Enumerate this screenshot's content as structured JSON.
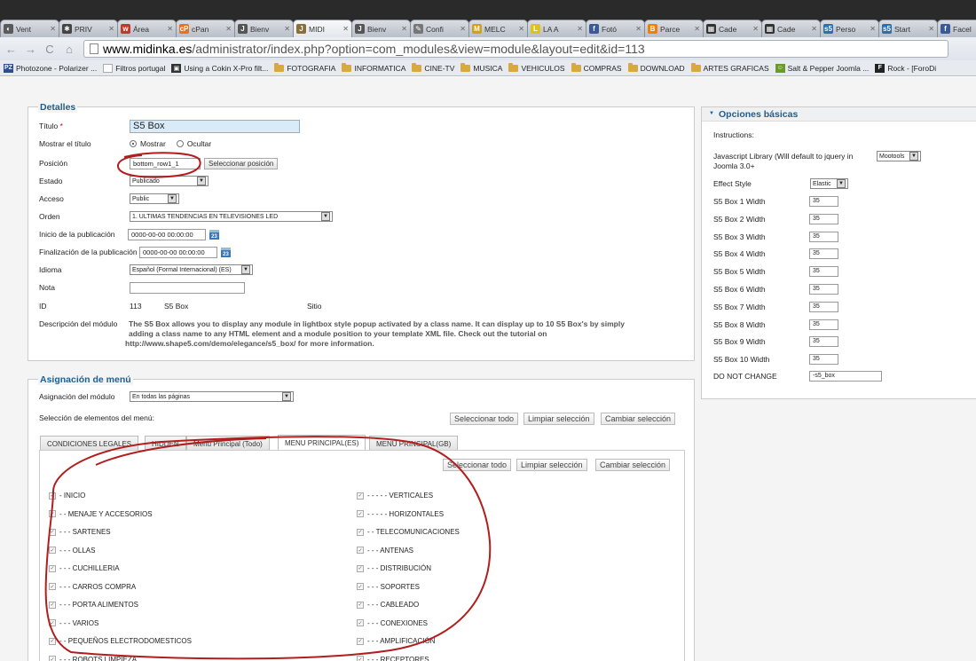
{
  "browser": {
    "tabs": [
      {
        "label": "Vent",
        "icon": "◐",
        "color": "#5a5a5a",
        "active": false
      },
      {
        "label": "PRIV",
        "icon": "✱",
        "color": "#444444",
        "active": false
      },
      {
        "label": "Área",
        "icon": "w",
        "color": "#c0392b",
        "active": false
      },
      {
        "label": "cPan",
        "icon": "cP",
        "color": "#e8731b",
        "active": false
      },
      {
        "label": "Bienv",
        "icon": "J",
        "color": "#555555",
        "active": false
      },
      {
        "label": "MIDI",
        "icon": "J",
        "color": "#8a6f3a",
        "active": true
      },
      {
        "label": "Bienv",
        "icon": "J",
        "color": "#555555",
        "active": false
      },
      {
        "label": "Confi",
        "icon": "✎",
        "color": "#777777",
        "active": false
      },
      {
        "label": "MELC",
        "icon": "M",
        "color": "#d4a017",
        "active": false
      },
      {
        "label": "LA A",
        "icon": "L",
        "color": "#e0c020",
        "active": false
      },
      {
        "label": "Fotó",
        "icon": "f",
        "color": "#3b5998",
        "active": false
      },
      {
        "label": "Parce",
        "icon": "B",
        "color": "#f57d00",
        "active": false
      },
      {
        "label": "Cade",
        "icon": "▦",
        "color": "#333333",
        "active": false
      },
      {
        "label": "Cade",
        "icon": "▦",
        "color": "#333333",
        "active": false
      },
      {
        "label": "Perso",
        "icon": "s5",
        "color": "#2a6fb0",
        "active": false
      },
      {
        "label": "Start",
        "icon": "s5",
        "color": "#2a6fb0",
        "active": false
      },
      {
        "label": "Facel",
        "icon": "f",
        "color": "#3b5998",
        "active": false
      }
    ],
    "tab_close": "✕",
    "nav": {
      "back": "←",
      "forward": "→",
      "reload": "C",
      "home": "⌂"
    },
    "url_domain": "www.midinka.es",
    "url_path": "/administrator/index.php?option=com_modules&view=module&layout=edit&id=113",
    "bookmarks": [
      {
        "label": "Photozone - Polarizer ...",
        "icon": "PZ",
        "color": "#2a4f8a"
      },
      {
        "label": "Filtros portugal",
        "icon": "",
        "color": "#ffffff"
      },
      {
        "label": "Using a Cokin X-Pro filt...",
        "icon": "▣",
        "color": "#333333"
      },
      {
        "label": "FOTOGRAFIA",
        "folder": true
      },
      {
        "label": "INFORMATICA",
        "folder": true
      },
      {
        "label": "CINE-TV",
        "folder": true
      },
      {
        "label": "MUSICA",
        "folder": true
      },
      {
        "label": "VEHICULOS",
        "folder": true
      },
      {
        "label": "COMPRAS",
        "folder": true
      },
      {
        "label": "DOWNLOAD",
        "folder": true
      },
      {
        "label": "ARTES GRAFICAS",
        "folder": true
      },
      {
        "label": "Salt & Pepper Joomla ...",
        "icon": "☺",
        "color": "#6a9a2a"
      },
      {
        "label": "Rock - [ForoDi",
        "icon": "F",
        "color": "#222222"
      }
    ]
  },
  "details": {
    "title": "Detalles",
    "titulo_label": "Título",
    "required_mark": "*",
    "titulo_value": "S5 Box",
    "mostrar_label": "Mostrar el título",
    "mostrar_opt": "Mostrar",
    "ocultar_opt": "Ocultar",
    "posicion_label": "Posición",
    "posicion_value": "bottom_row1_1",
    "posicion_btn": "Seleccionar posición",
    "estado_label": "Estado",
    "estado_value": "Publicado",
    "acceso_label": "Acceso",
    "acceso_value": "Public",
    "orden_label": "Orden",
    "orden_value": "1. ULTIMAS TENDENCIAS EN TELEVISIONES LED",
    "inicio_label": "Inicio de la publicación",
    "inicio_value": "0000-00-00 00:00:00",
    "fin_label": "Finalización de la publicación",
    "fin_value": "0000-00-00 00:00:00",
    "calendar_glyph": "23",
    "idioma_label": "Idioma",
    "idioma_value": "Español (Formal Internacional) (ES)",
    "nota_label": "Nota",
    "nota_value": "",
    "id_label": "ID",
    "id_value": "113",
    "id_type": "S5 Box",
    "id_site": "Sitio",
    "desc_label": "Descripción del módulo",
    "desc_line1": "The S5 Box allows you to display any module in lightbox style popup activated by a class name. It can display up to 10 S5 Box's by simply",
    "desc_line2": "adding a class name to any HTML element and a module position to your template XML file. Check out the tutorial on",
    "desc_line3": "http://www.shape5.com/demo/elegance/s5_box/ for more information."
  },
  "menu": {
    "title": "Asignación de menú",
    "asignacion_label": "Asignación del módulo",
    "asignacion_value": "En todas las páginas",
    "seleccion_label": "Selección de elementos del menú:",
    "btn_select_all": "Seleccionar todo",
    "btn_clear": "Limpiar selección",
    "btn_toggle": "Cambiar selección",
    "tabs": [
      "CONDICIONES LEGALES",
      "HIDDEN",
      "Menu Principal (Todo)",
      "MENU PRINCIPAL(ES)",
      "MENU PRINCIPAL(GB)"
    ],
    "left_items": [
      "- INICIO",
      "- - MENAJE Y ACCESORIOS",
      "- - - SARTENES",
      "- - - OLLAS",
      "- - - CUCHILLERIA",
      "- - - CARROS COMPRA",
      "- - - PORTA ALIMENTOS",
      "- - - VARIOS",
      "- - PEQUEÑOS ELECTRODOMESTICOS",
      "- - - ROBOTS LIMPIEZA"
    ],
    "right_items": [
      "- - - - - VERTICALES",
      "- - - - - HORIZONTALES",
      "- - TELECOMUNICACIONES",
      "- - - ANTENAS",
      "- - - DISTRIBUCIÓN",
      "- - - SOPORTES",
      "- - - CABLEADO",
      "- - - CONEXIONES",
      "- - - AMPLIFICACIÓN",
      "- - - RECEPTORES"
    ],
    "check_glyph": "✓"
  },
  "options": {
    "title": "Opciones básicas",
    "toggle_glyph": "▼",
    "instructions": "Instructions:",
    "js_label_1": "Javascript Library (Will default to jquery in",
    "js_label_2": "Joomla 3.0+",
    "js_value": "Mootools",
    "effect_label": "Effect Style",
    "effect_value": "Elastic",
    "widths": [
      {
        "label": "S5 Box 1 Width",
        "value": "35"
      },
      {
        "label": "S5 Box 2 Width",
        "value": "35"
      },
      {
        "label": "S5 Box 3 Width",
        "value": "35"
      },
      {
        "label": "S5 Box 4 Width",
        "value": "35"
      },
      {
        "label": "S5 Box 5 Width",
        "value": "35"
      },
      {
        "label": "S5 Box 6 Width",
        "value": "35"
      },
      {
        "label": "S5 Box 7 Width",
        "value": "35"
      },
      {
        "label": "S5 Box 8 Width",
        "value": "35"
      },
      {
        "label": "S5 Box 9 Width",
        "value": "35"
      },
      {
        "label": "S5 Box 10 Width",
        "value": "35"
      }
    ],
    "dnc_label": "DO NOT CHANGE",
    "dnc_value": "-s5_box",
    "select_arrow": "▼"
  },
  "colors": {
    "accent": "#1f5e8e",
    "annotation": "#b21d1d"
  }
}
